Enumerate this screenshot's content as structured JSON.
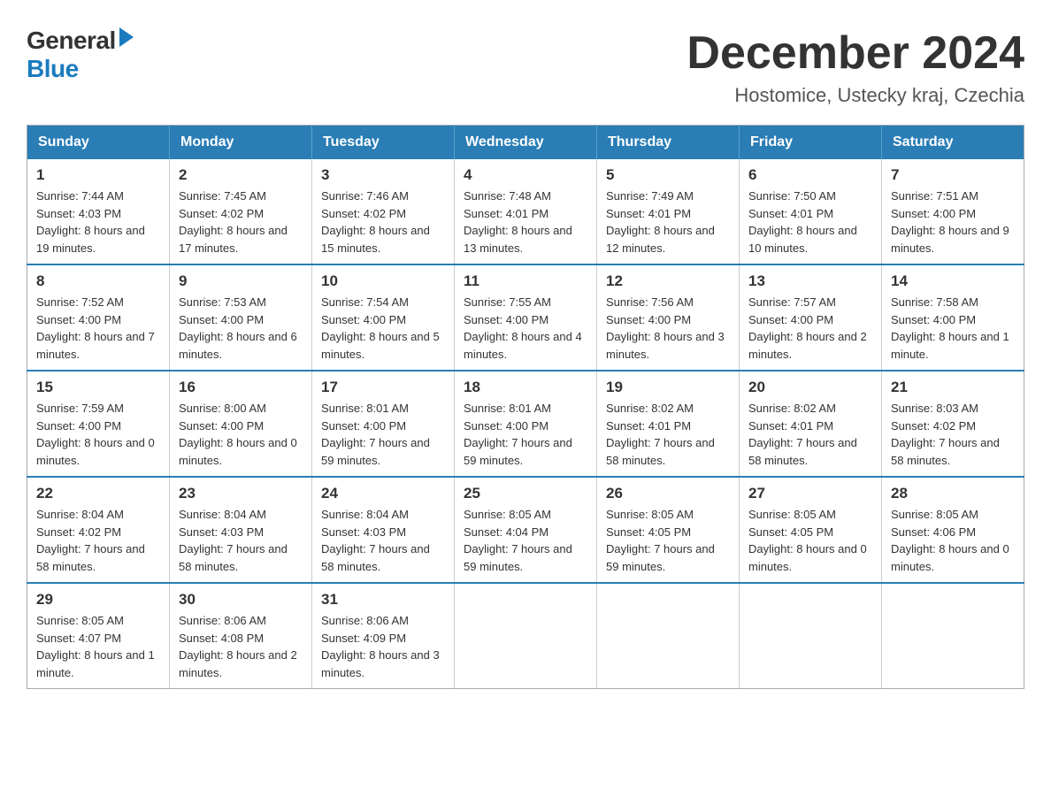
{
  "logo": {
    "general": "General",
    "blue": "Blue"
  },
  "title": "December 2024",
  "subtitle": "Hostomice, Ustecky kraj, Czechia",
  "headers": [
    "Sunday",
    "Monday",
    "Tuesday",
    "Wednesday",
    "Thursday",
    "Friday",
    "Saturday"
  ],
  "weeks": [
    [
      {
        "day": "1",
        "sunrise": "7:44 AM",
        "sunset": "4:03 PM",
        "daylight": "8 hours and 19 minutes."
      },
      {
        "day": "2",
        "sunrise": "7:45 AM",
        "sunset": "4:02 PM",
        "daylight": "8 hours and 17 minutes."
      },
      {
        "day": "3",
        "sunrise": "7:46 AM",
        "sunset": "4:02 PM",
        "daylight": "8 hours and 15 minutes."
      },
      {
        "day": "4",
        "sunrise": "7:48 AM",
        "sunset": "4:01 PM",
        "daylight": "8 hours and 13 minutes."
      },
      {
        "day": "5",
        "sunrise": "7:49 AM",
        "sunset": "4:01 PM",
        "daylight": "8 hours and 12 minutes."
      },
      {
        "day": "6",
        "sunrise": "7:50 AM",
        "sunset": "4:01 PM",
        "daylight": "8 hours and 10 minutes."
      },
      {
        "day": "7",
        "sunrise": "7:51 AM",
        "sunset": "4:00 PM",
        "daylight": "8 hours and 9 minutes."
      }
    ],
    [
      {
        "day": "8",
        "sunrise": "7:52 AM",
        "sunset": "4:00 PM",
        "daylight": "8 hours and 7 minutes."
      },
      {
        "day": "9",
        "sunrise": "7:53 AM",
        "sunset": "4:00 PM",
        "daylight": "8 hours and 6 minutes."
      },
      {
        "day": "10",
        "sunrise": "7:54 AM",
        "sunset": "4:00 PM",
        "daylight": "8 hours and 5 minutes."
      },
      {
        "day": "11",
        "sunrise": "7:55 AM",
        "sunset": "4:00 PM",
        "daylight": "8 hours and 4 minutes."
      },
      {
        "day": "12",
        "sunrise": "7:56 AM",
        "sunset": "4:00 PM",
        "daylight": "8 hours and 3 minutes."
      },
      {
        "day": "13",
        "sunrise": "7:57 AM",
        "sunset": "4:00 PM",
        "daylight": "8 hours and 2 minutes."
      },
      {
        "day": "14",
        "sunrise": "7:58 AM",
        "sunset": "4:00 PM",
        "daylight": "8 hours and 1 minute."
      }
    ],
    [
      {
        "day": "15",
        "sunrise": "7:59 AM",
        "sunset": "4:00 PM",
        "daylight": "8 hours and 0 minutes."
      },
      {
        "day": "16",
        "sunrise": "8:00 AM",
        "sunset": "4:00 PM",
        "daylight": "8 hours and 0 minutes."
      },
      {
        "day": "17",
        "sunrise": "8:01 AM",
        "sunset": "4:00 PM",
        "daylight": "7 hours and 59 minutes."
      },
      {
        "day": "18",
        "sunrise": "8:01 AM",
        "sunset": "4:00 PM",
        "daylight": "7 hours and 59 minutes."
      },
      {
        "day": "19",
        "sunrise": "8:02 AM",
        "sunset": "4:01 PM",
        "daylight": "7 hours and 58 minutes."
      },
      {
        "day": "20",
        "sunrise": "8:02 AM",
        "sunset": "4:01 PM",
        "daylight": "7 hours and 58 minutes."
      },
      {
        "day": "21",
        "sunrise": "8:03 AM",
        "sunset": "4:02 PM",
        "daylight": "7 hours and 58 minutes."
      }
    ],
    [
      {
        "day": "22",
        "sunrise": "8:04 AM",
        "sunset": "4:02 PM",
        "daylight": "7 hours and 58 minutes."
      },
      {
        "day": "23",
        "sunrise": "8:04 AM",
        "sunset": "4:03 PM",
        "daylight": "7 hours and 58 minutes."
      },
      {
        "day": "24",
        "sunrise": "8:04 AM",
        "sunset": "4:03 PM",
        "daylight": "7 hours and 58 minutes."
      },
      {
        "day": "25",
        "sunrise": "8:05 AM",
        "sunset": "4:04 PM",
        "daylight": "7 hours and 59 minutes."
      },
      {
        "day": "26",
        "sunrise": "8:05 AM",
        "sunset": "4:05 PM",
        "daylight": "7 hours and 59 minutes."
      },
      {
        "day": "27",
        "sunrise": "8:05 AM",
        "sunset": "4:05 PM",
        "daylight": "8 hours and 0 minutes."
      },
      {
        "day": "28",
        "sunrise": "8:05 AM",
        "sunset": "4:06 PM",
        "daylight": "8 hours and 0 minutes."
      }
    ],
    [
      {
        "day": "29",
        "sunrise": "8:05 AM",
        "sunset": "4:07 PM",
        "daylight": "8 hours and 1 minute."
      },
      {
        "day": "30",
        "sunrise": "8:06 AM",
        "sunset": "4:08 PM",
        "daylight": "8 hours and 2 minutes."
      },
      {
        "day": "31",
        "sunrise": "8:06 AM",
        "sunset": "4:09 PM",
        "daylight": "8 hours and 3 minutes."
      },
      null,
      null,
      null,
      null
    ]
  ]
}
